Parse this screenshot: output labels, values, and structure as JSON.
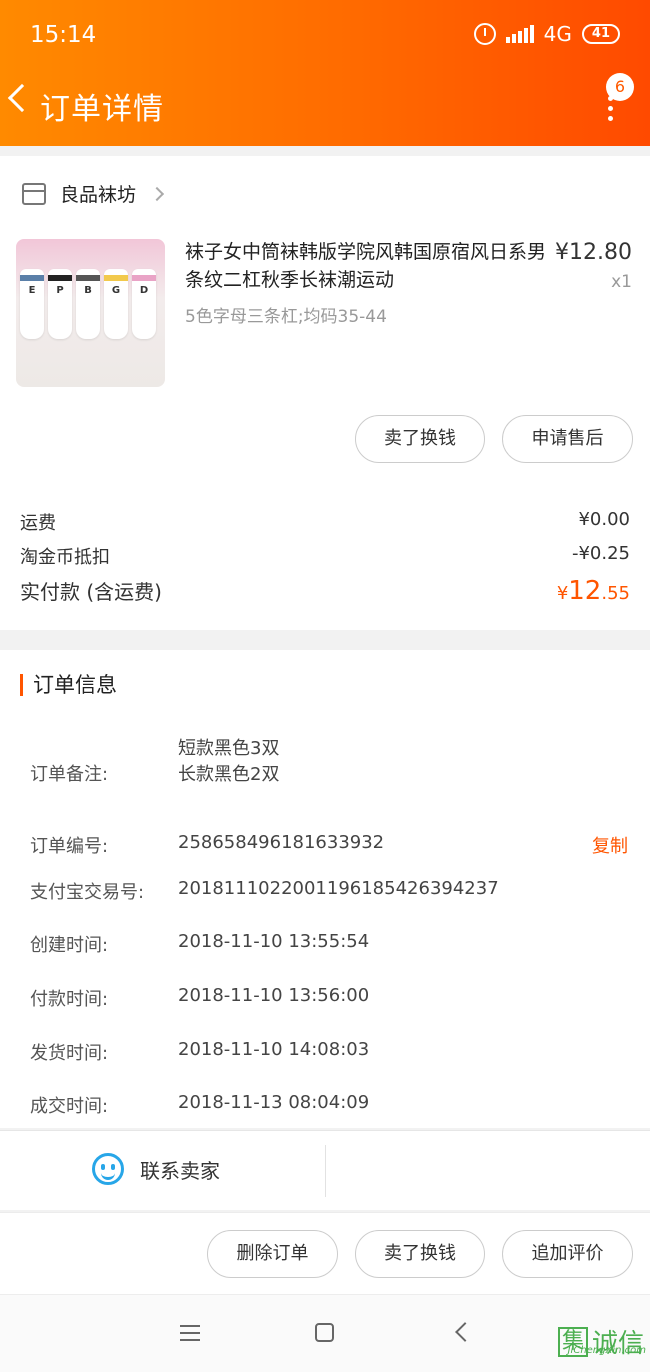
{
  "status_bar": {
    "time": "15:14",
    "network": "4G",
    "battery": "41"
  },
  "header": {
    "title": "订单详情",
    "badge_count": "6"
  },
  "shop": {
    "name": "良品袜坊"
  },
  "product": {
    "name": "袜子女中筒袜韩版学院风韩国原宿风日系男条纹二杠秋季长袜潮运动",
    "spec": "5色字母三条杠;均码35-44",
    "price": "¥12.80",
    "quantity": "x1",
    "sock_letters": [
      "E",
      "P",
      "B",
      "G",
      "D"
    ]
  },
  "item_actions": {
    "sell_label": "卖了换钱",
    "after_sale_label": "申请售后"
  },
  "summary": {
    "shipping_label": "运费",
    "shipping_value": "¥0.00",
    "coin_label": "淘金币抵扣",
    "coin_value": "-¥0.25",
    "total_label": "实付款 (含运费)",
    "total_currency": "¥",
    "total_int": "12",
    "total_dec": ".55"
  },
  "order_info": {
    "section_title": "订单信息",
    "remark_label": "订单备注:",
    "remark_line1": "短款黑色3双",
    "remark_line2": "长款黑色2双",
    "order_no_label": "订单编号:",
    "order_no": "258658496181633932",
    "copy_label": "复制",
    "alipay_label": "支付宝交易号:",
    "alipay_no": "2018111022001196185426394237",
    "created_label": "创建时间:",
    "created": "2018-11-10 13:55:54",
    "paid_label": "付款时间:",
    "paid": "2018-11-10 13:56:00",
    "shipped_label": "发货时间:",
    "shipped": "2018-11-10 14:08:03",
    "done_label": "成交时间:",
    "done": "2018-11-13 08:04:09"
  },
  "contact": {
    "label": "联系卖家"
  },
  "bottom_actions": {
    "delete_label": "删除订单",
    "sell_label": "卖了换钱",
    "review_label": "追加评价"
  },
  "watermark": {
    "char": "集",
    "text": "诚信",
    "sub": "JiChengXin.com"
  }
}
